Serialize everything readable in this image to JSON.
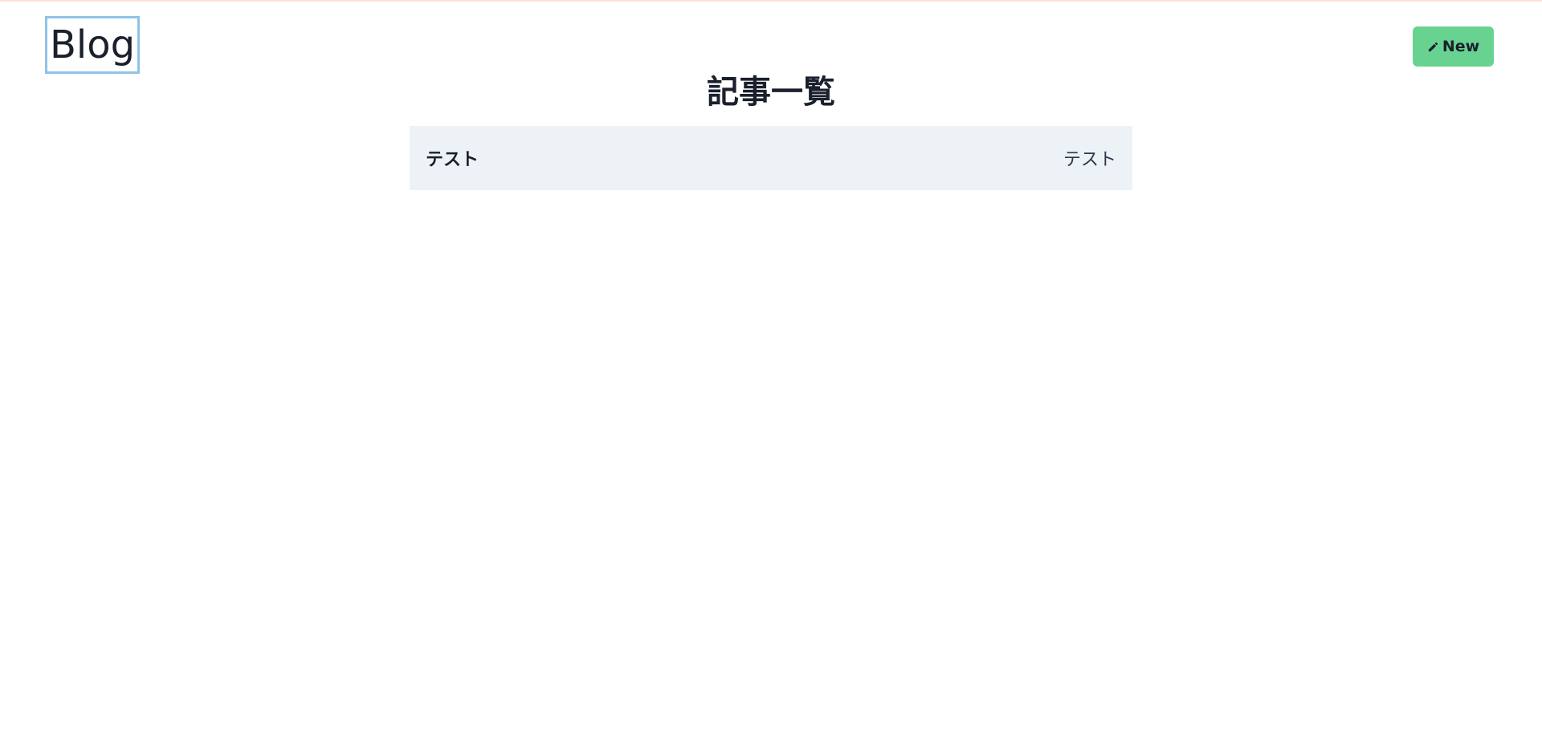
{
  "header": {
    "logo_text": "Blog",
    "new_button_label": "New",
    "new_button_icon": "pencil-icon"
  },
  "main": {
    "title": "記事一覧",
    "posts": [
      {
        "title": "テスト",
        "excerpt": "テスト"
      }
    ]
  },
  "colors": {
    "new_button_bg": "#68d391",
    "list_item_bg": "#edf2f7",
    "logo_focus_ring": "#90c2e7",
    "text": "#1a202c"
  }
}
